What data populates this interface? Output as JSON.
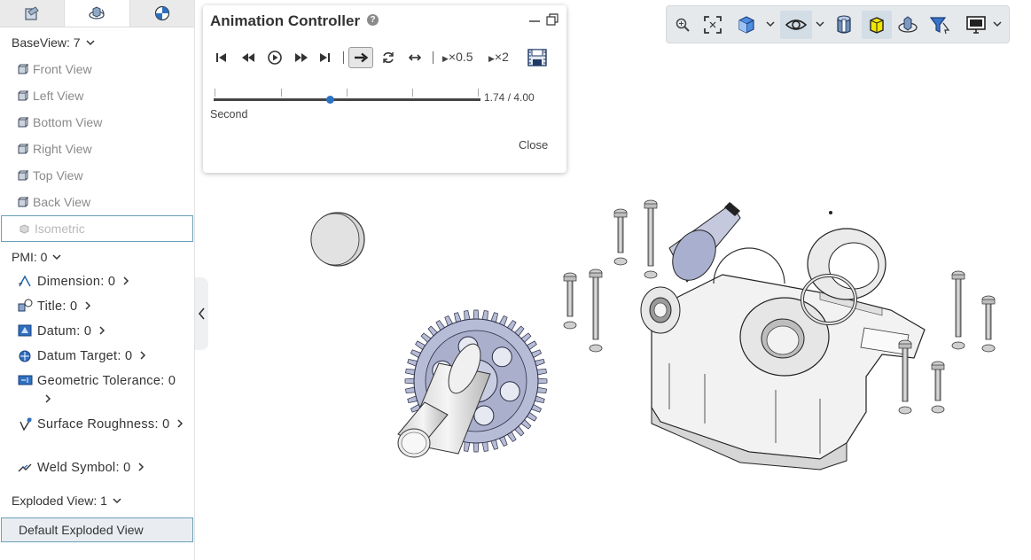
{
  "tabs": [
    {
      "name": "assembly-tab"
    },
    {
      "name": "views-tab",
      "active": true
    },
    {
      "name": "render-tab"
    }
  ],
  "baseview": {
    "label": "BaseView: 7",
    "items": [
      {
        "label": "Front View"
      },
      {
        "label": "Left View"
      },
      {
        "label": "Bottom View"
      },
      {
        "label": "Right View"
      },
      {
        "label": "Top View"
      },
      {
        "label": "Back View"
      },
      {
        "label": "Isometric",
        "selected": true
      }
    ]
  },
  "pmi": {
    "label": "PMI: 0",
    "items": [
      {
        "label": "Dimension: 0",
        "icon": "dimension-icon"
      },
      {
        "label": "Title: 0",
        "icon": "title-icon"
      },
      {
        "label": "Datum: 0",
        "icon": "datum-icon"
      },
      {
        "label": "Datum Target: 0",
        "icon": "datum-target-icon"
      },
      {
        "label": "Geometric Tolerance: 0",
        "icon": "geometric-tolerance-icon"
      },
      {
        "label": "Surface Roughness: 0",
        "icon": "surface-roughness-icon"
      },
      {
        "label": "Weld Symbol: 0",
        "icon": "weld-symbol-icon"
      }
    ]
  },
  "exploded": {
    "label": "Exploded View: 1",
    "items": [
      {
        "label": "Default Exploded View",
        "selected": true
      }
    ]
  },
  "animation": {
    "title": "Animation Controller",
    "help": "?",
    "speed_half": "×0.5",
    "speed_double": "×2",
    "current_time": 1.74,
    "total_time": 4.0,
    "time_readout": "1.74 / 4.00",
    "time_unit": "Second",
    "close_label": "Close",
    "direction": "forward"
  },
  "toolbar": {
    "buttons": [
      "zoom-icon",
      "fit-view-icon",
      "view-cube-icon",
      "visibility-eye-icon",
      "section-icon",
      "highlight-cube-icon",
      "explode-icon",
      "filter-icon",
      "display-icon"
    ],
    "active": [
      "visibility-eye-icon",
      "highlight-cube-icon"
    ]
  },
  "colors": {
    "accent": "#2a72c4",
    "selection_border": "#6a9fb8",
    "toolbar_bg": "#e6e9ec",
    "part_fill": "#e8e8e8",
    "gear_fill": "#b7bcd6"
  }
}
